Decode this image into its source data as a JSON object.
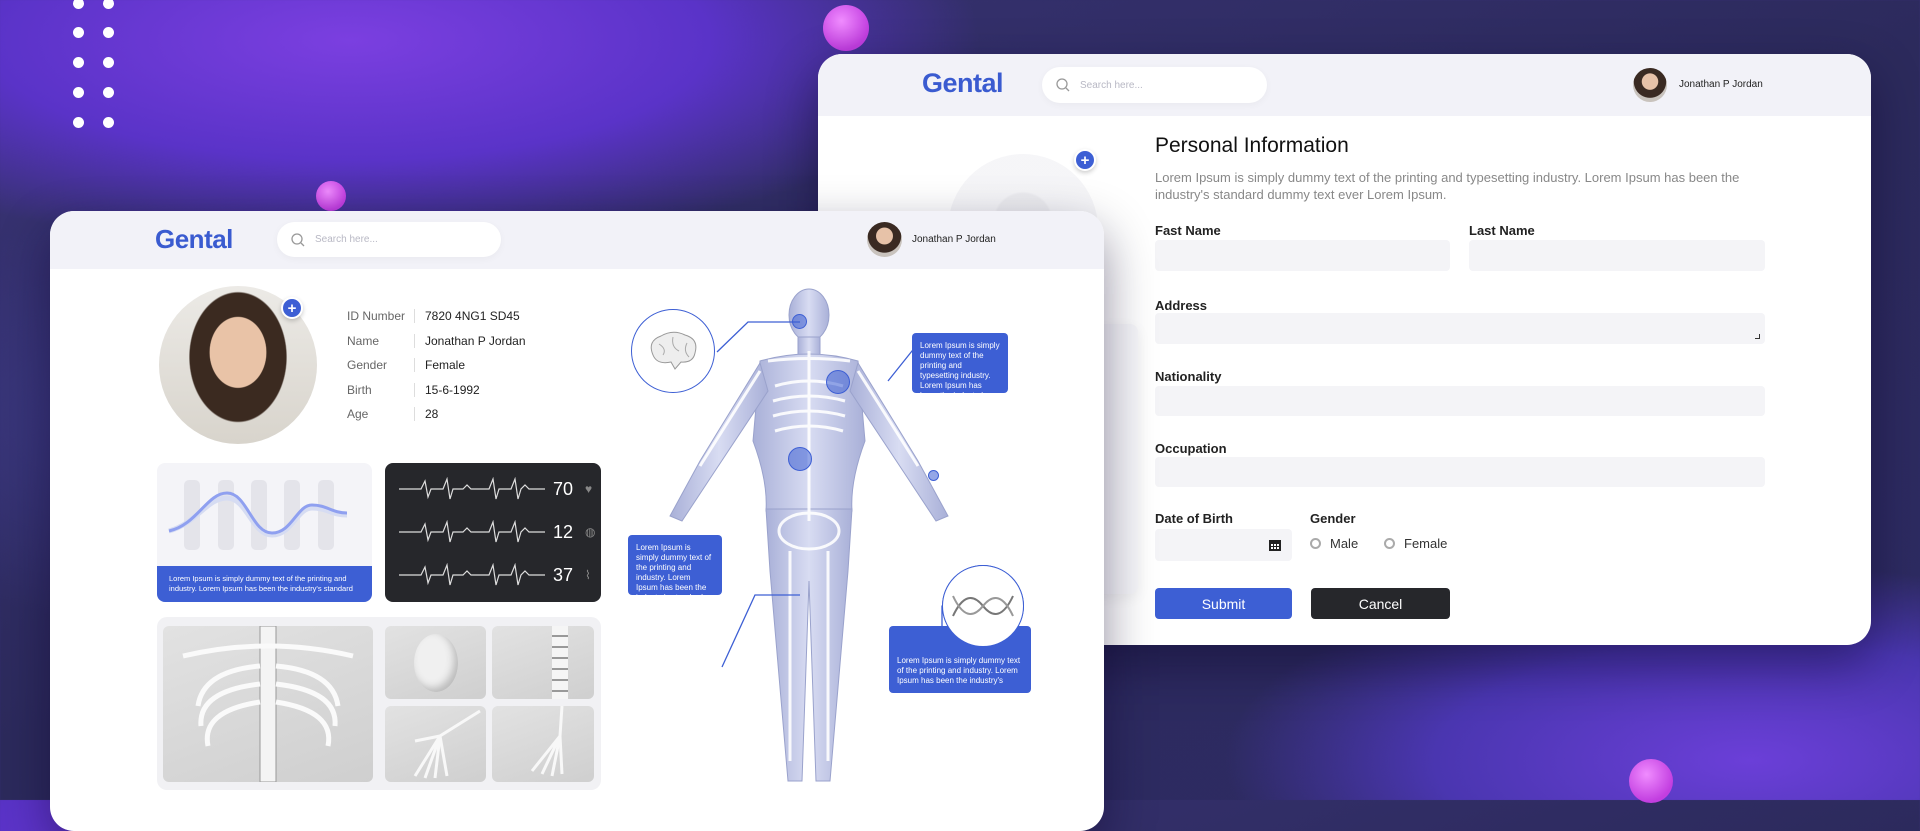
{
  "back_window": {
    "logo": "Gental",
    "search_placeholder": "Search here...",
    "user_name": "Jonathan P Jordan",
    "form": {
      "title": "Personal Information",
      "description": "Lorem Ipsum is simply dummy text of the printing and typesetting industry. Lorem Ipsum has been the industry's standard dummy text ever Lorem Ipsum.",
      "first_name_label": "Fast Name",
      "last_name_label": "Last Name",
      "address_label": "Address",
      "nationality_label": "Nationality",
      "occupation_label": "Occupation",
      "dob_label": "Date of Birth",
      "gender_label": "Gender",
      "gender_options": [
        "Male",
        "Female"
      ],
      "submit_label": "Submit",
      "cancel_label": "Cancel"
    }
  },
  "front_window": {
    "logo": "Gental",
    "search_placeholder": "Search here...",
    "user_name": "Jonathan P Jordan",
    "profile": [
      {
        "label": "ID Number",
        "value": "7820 4NG1 SD45"
      },
      {
        "label": "Name",
        "value": "Jonathan P Jordan"
      },
      {
        "label": "Gender",
        "value": "Female"
      },
      {
        "label": "Birth",
        "value": "15-6-1992"
      },
      {
        "label": "Age",
        "value": "28"
      }
    ],
    "chart_caption": "Lorem Ipsum is simply dummy text of the printing and industry. Lorem Ipsum has been the industry's standard",
    "vitals": [
      {
        "value": "70",
        "icon": "heart-icon"
      },
      {
        "value": "12",
        "icon": "lungs-icon"
      },
      {
        "value": "37",
        "icon": "thermometer-icon"
      }
    ],
    "callouts": {
      "top_right": "Lorem Ipsum is simply dummy text of the printing and typesetting industry. Lorem Ipsum has been the industry's",
      "left": "Lorem Ipsum is simply dummy text of the printing and industry. Lorem Ipsum has been the industry's standard",
      "bottom_right": "Lorem Ipsum is simply dummy text of the printing and industry. Lorem Ipsum has been the industry's"
    }
  },
  "colors": {
    "accent": "#3d5fd4",
    "dark": "#26272b",
    "background": "#2e2b64"
  }
}
